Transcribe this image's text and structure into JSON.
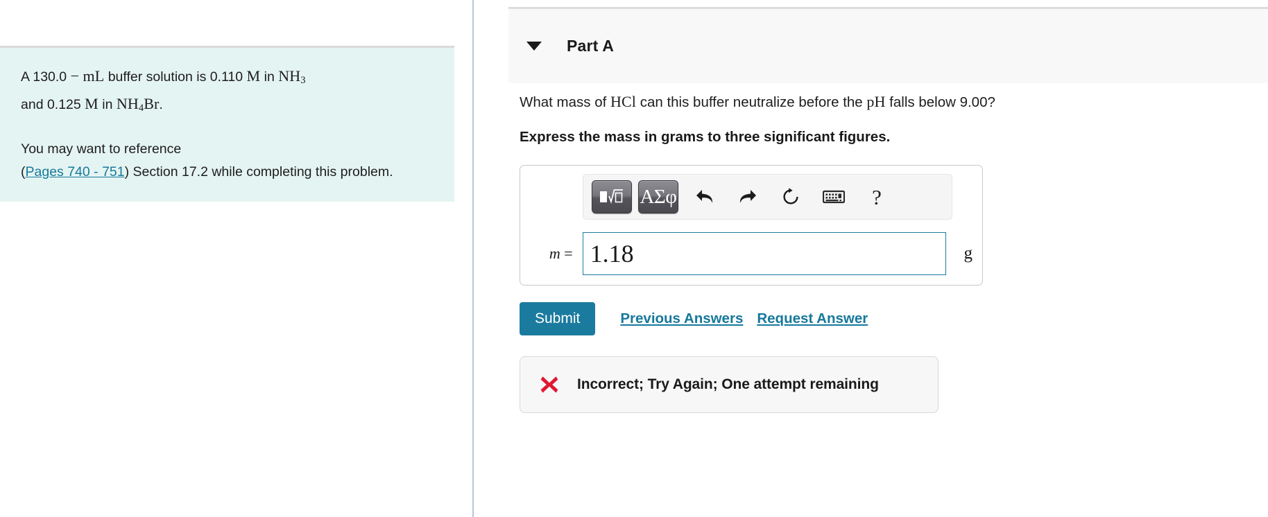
{
  "left_panel": {
    "problem": {
      "line1_pre": "A 130.0 ",
      "line1_dash": "−",
      "line1_ml": "mL",
      "line1_mid": " buffer solution is 0.110 ",
      "line1_m": "M",
      "line1_in": " in ",
      "line1_nh3": "NH",
      "line1_nh3_sub": "3",
      "line2_pre": " and 0.125 ",
      "line2_m": "M",
      "line2_in": " in ",
      "line2_nh": "NH",
      "line2_nh_sub": "4",
      "line2_br": "Br",
      "line2_period": ".",
      "reference_pre": "You may want to reference",
      "reference_open_paren": "(",
      "reference_link": "Pages 740 - 751",
      "reference_close": ") Section 17.2 while completing this problem."
    }
  },
  "right_panel": {
    "part": {
      "title": "Part A",
      "caret_icon": "caret-down-icon"
    },
    "question": "What mass of HCl can this buffer neutralize before the pH falls below 9.00?",
    "question_parts": {
      "pre": "What mass of ",
      "hcl": "HCl",
      "mid": " can this buffer neutralize before the ",
      "ph": "pH",
      "post": " falls below 9.00?"
    },
    "instruction": "Express the mass in grams to three significant figures.",
    "math_toolbar": {
      "buttons": [
        {
          "name": "template-sqrt-button",
          "label": "√□"
        },
        {
          "name": "greek-symbols-button",
          "label": "ΑΣφ"
        },
        {
          "name": "undo-icon",
          "label": "undo"
        },
        {
          "name": "redo-icon",
          "label": "redo"
        },
        {
          "name": "reset-icon",
          "label": "reset"
        },
        {
          "name": "keyboard-icon",
          "label": "keyboard"
        },
        {
          "name": "help-icon",
          "label": "?"
        }
      ],
      "greek_label": "ΑΣφ",
      "help_label": "?"
    },
    "answer": {
      "variable_label": "m",
      "equals": " =",
      "value": "1.18",
      "unit": "g"
    },
    "actions": {
      "submit_label": "Submit",
      "previous_answers_label": "Previous Answers",
      "request_answer_label": "Request Answer"
    },
    "feedback": {
      "icon": "x-mark-icon",
      "message": "Incorrect; Try Again; One attempt remaining"
    }
  },
  "colors": {
    "info_box_bg": "#e4f4f2",
    "link": "#17799c",
    "submit_bg": "#1a7b9e",
    "input_border": "#1b7b9c",
    "divider": "#b6c7d8",
    "feedback_icon": "#e01832",
    "header_bg": "#f8f8f8"
  }
}
